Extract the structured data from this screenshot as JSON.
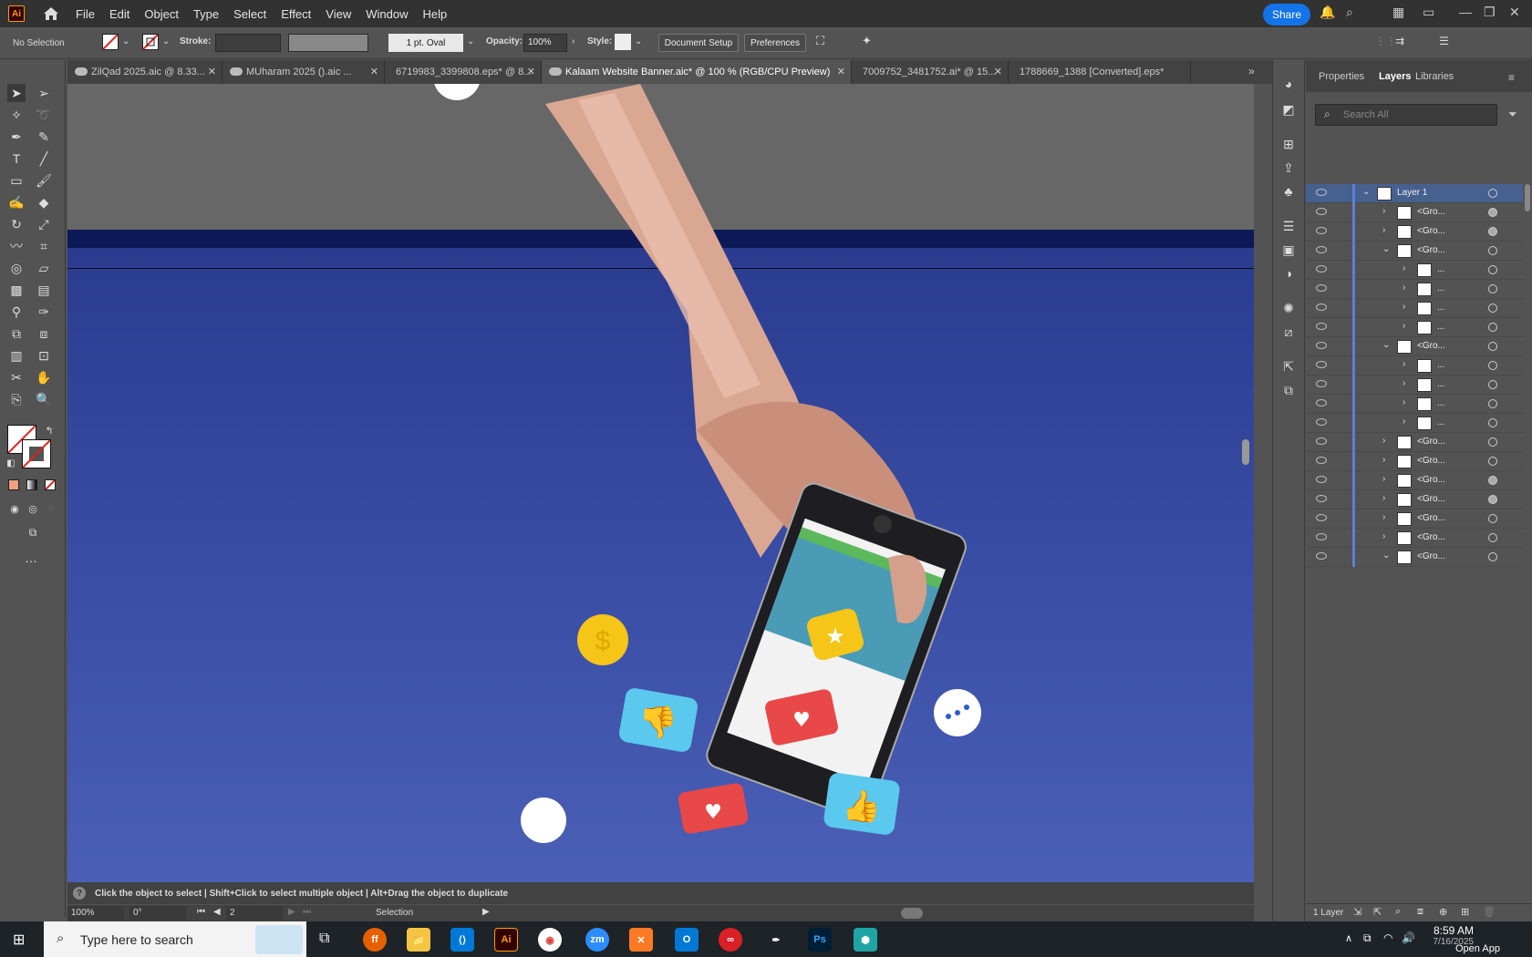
{
  "app": {
    "logo": "Ai",
    "name": "Adobe Illustrator"
  },
  "menu": [
    "File",
    "Edit",
    "Object",
    "Type",
    "Select",
    "Effect",
    "View",
    "Window",
    "Help"
  ],
  "share_label": "Share",
  "control": {
    "selection": "No Selection",
    "stroke_label": "Stroke:",
    "brush": "1 pt. Oval",
    "opacity_label": "Opacity:",
    "opacity_value": "100%",
    "style_label": "Style:",
    "document_setup": "Document Setup",
    "preferences": "Preferences"
  },
  "tabs": [
    {
      "label": "ZilQad 2025.aic @ 8.33..."
    },
    {
      "label": "MUharam 2025 ().aic ..."
    },
    {
      "label": "6719983_3399808.eps* @ 8..."
    },
    {
      "label": "Kalaam Website Banner.aic* @ 100 % (RGB/CPU Preview)"
    },
    {
      "label": "7009752_3481752.ai* @ 15..."
    },
    {
      "label": "1788669_1388 [Converted].eps*"
    }
  ],
  "active_tab": 3,
  "panel": {
    "tabs": [
      "Properties",
      "Layers",
      "Libraries"
    ],
    "active": "Layers",
    "search_placeholder": "Search All",
    "footer_layers": "1 Layer"
  },
  "layers": [
    {
      "indent": 0,
      "expanded": true,
      "name": "Layer 1",
      "target_filled": false,
      "selected": true
    },
    {
      "indent": 1,
      "expanded": false,
      "name": "<Gro...",
      "target_filled": true
    },
    {
      "indent": 1,
      "expanded": false,
      "name": "<Gro...",
      "target_filled": true
    },
    {
      "indent": 1,
      "expanded": true,
      "name": "<Gro...",
      "target_filled": false
    },
    {
      "indent": 2,
      "expanded": false,
      "name": "...",
      "target_filled": false
    },
    {
      "indent": 2,
      "expanded": false,
      "name": "...",
      "target_filled": false
    },
    {
      "indent": 2,
      "expanded": false,
      "name": "...",
      "target_filled": false
    },
    {
      "indent": 2,
      "expanded": false,
      "name": "...",
      "target_filled": false
    },
    {
      "indent": 1,
      "expanded": true,
      "name": "<Gro...",
      "target_filled": false
    },
    {
      "indent": 2,
      "expanded": false,
      "name": "...",
      "target_filled": false
    },
    {
      "indent": 2,
      "expanded": false,
      "name": "...",
      "target_filled": false
    },
    {
      "indent": 2,
      "expanded": false,
      "name": "...",
      "target_filled": false
    },
    {
      "indent": 2,
      "expanded": false,
      "name": "...",
      "target_filled": false
    },
    {
      "indent": 1,
      "expanded": false,
      "name": "<Gro...",
      "target_filled": false
    },
    {
      "indent": 1,
      "expanded": false,
      "name": "<Gro...",
      "target_filled": false
    },
    {
      "indent": 1,
      "expanded": false,
      "name": "<Gro...",
      "target_filled": true
    },
    {
      "indent": 1,
      "expanded": false,
      "name": "<Gro...",
      "target_filled": true
    },
    {
      "indent": 1,
      "expanded": false,
      "name": "<Gro...",
      "target_filled": false
    },
    {
      "indent": 1,
      "expanded": false,
      "name": "<Gro...",
      "target_filled": false
    },
    {
      "indent": 1,
      "expanded": true,
      "name": "<Gro...",
      "target_filled": false
    }
  ],
  "status": {
    "hint": "Click the object to select  |  Shift+Click to select multiple object  |  Alt+Drag the object to duplicate",
    "zoom": "100%",
    "rotation": "0°",
    "artboard": "2",
    "tool": "Selection"
  },
  "taskbar": {
    "search_placeholder": "Type here to search",
    "time": "8:59 AM",
    "date": "7/16/2025",
    "open_app": "Open App"
  },
  "colors": {
    "accent": "#1473e6",
    "artboard": "#3a4ea6",
    "selection": "#5b7fd6"
  }
}
